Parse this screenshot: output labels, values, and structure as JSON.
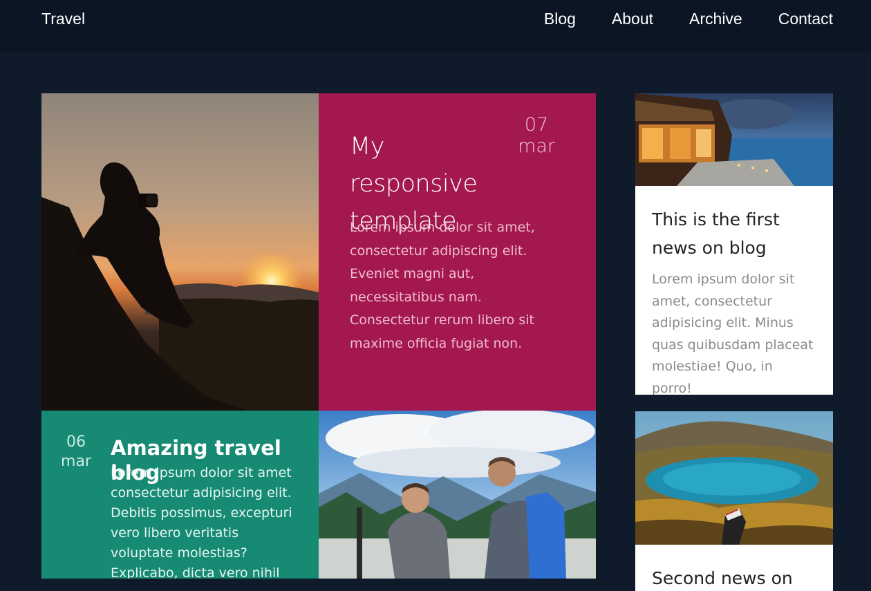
{
  "header": {
    "brand": "Travel",
    "nav": [
      "Blog",
      "About",
      "Archive",
      "Contact"
    ]
  },
  "posts": [
    {
      "title": "My responsive template",
      "day": "07",
      "month": "mar",
      "text": "Lorem ipsum dolor sit amet, consectetur adipiscing elit. Eveniet magni aut, necessitatibus nam. Consectetur rerum libero sit maxime officia fugiat non."
    },
    {
      "title": "Amazing travel blog",
      "day": "06",
      "month": "mar",
      "text": "Lorem ipsum dolor sit amet consectetur adipisicing elit. Debitis possimus, excepturi vero libero veritatis voluptate molestias? Explicabo, dicta vero nihil nisi illo fugiat"
    }
  ],
  "sidebar": [
    {
      "title": "This is the first news on blog",
      "text": "Lorem ipsum dolor sit amet, consectetur adipisicing elit. Minus quas quibusdam placeat molestiae! Quo, in porro!"
    },
    {
      "title": "Second news on",
      "text": ""
    }
  ],
  "colors": {
    "background": "#0f1a2b",
    "header": "#0b1524",
    "card_magenta": "#a3184e",
    "card_teal": "#178a74"
  }
}
